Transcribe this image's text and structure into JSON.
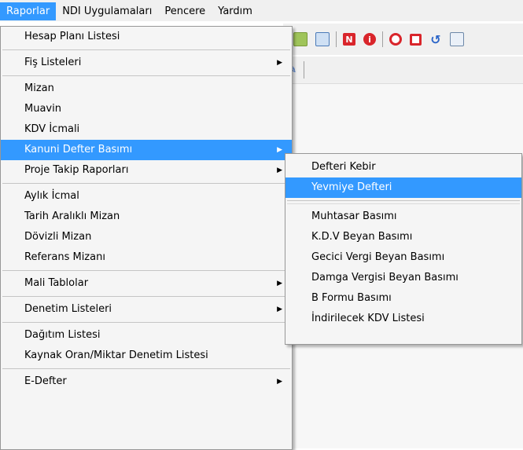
{
  "menubar": {
    "items": [
      {
        "label": "Raporlar"
      },
      {
        "label": "NDI Uygulamaları"
      },
      {
        "label": "Pencere"
      },
      {
        "label": "Yardım"
      }
    ]
  },
  "toolbar": {
    "icons": [
      "grid-icon",
      "grid-table-icon",
      "n-red-icon",
      "info-red-icon",
      "record-red-icon",
      "stop-red-icon",
      "refresh-blue-icon",
      "calendar-icon"
    ]
  },
  "main_menu": {
    "items": [
      {
        "label": "Hesap Planı Listesi"
      },
      {
        "label": "Fiş Listeleri"
      },
      {
        "label": "Mizan"
      },
      {
        "label": "Muavin"
      },
      {
        "label": "KDV İcmali"
      },
      {
        "label": "Kanuni Defter Basımı"
      },
      {
        "label": "Proje Takip Raporları"
      },
      {
        "label": "Aylık İcmal"
      },
      {
        "label": "Tarih Aralıklı Mizan"
      },
      {
        "label": "Dövizli Mizan"
      },
      {
        "label": "Referans Mizanı"
      },
      {
        "label": "Mali Tablolar"
      },
      {
        "label": "Denetim Listeleri"
      },
      {
        "label": "Dağıtım Listesi"
      },
      {
        "label": "Kaynak Oran/Miktar Denetim Listesi"
      },
      {
        "label": "E-Defter"
      }
    ]
  },
  "sub_menu": {
    "items": [
      {
        "label": "Defteri Kebir"
      },
      {
        "label": "Yevmiye Defteri"
      },
      {
        "label": "Muhtasar Basımı"
      },
      {
        "label": "K.D.V Beyan Basımı"
      },
      {
        "label": "Gecici Vergi Beyan Basımı"
      },
      {
        "label": "Damga Vergisi Beyan Basımı"
      },
      {
        "label": "B Formu Basımı"
      },
      {
        "label": "İndirilecek KDV Listesi"
      }
    ]
  },
  "colors": {
    "highlight": "#3399ff",
    "menu_bg": "#f5f5f5",
    "icon_red": "#d9252b",
    "icon_blue": "#2a64c8"
  }
}
